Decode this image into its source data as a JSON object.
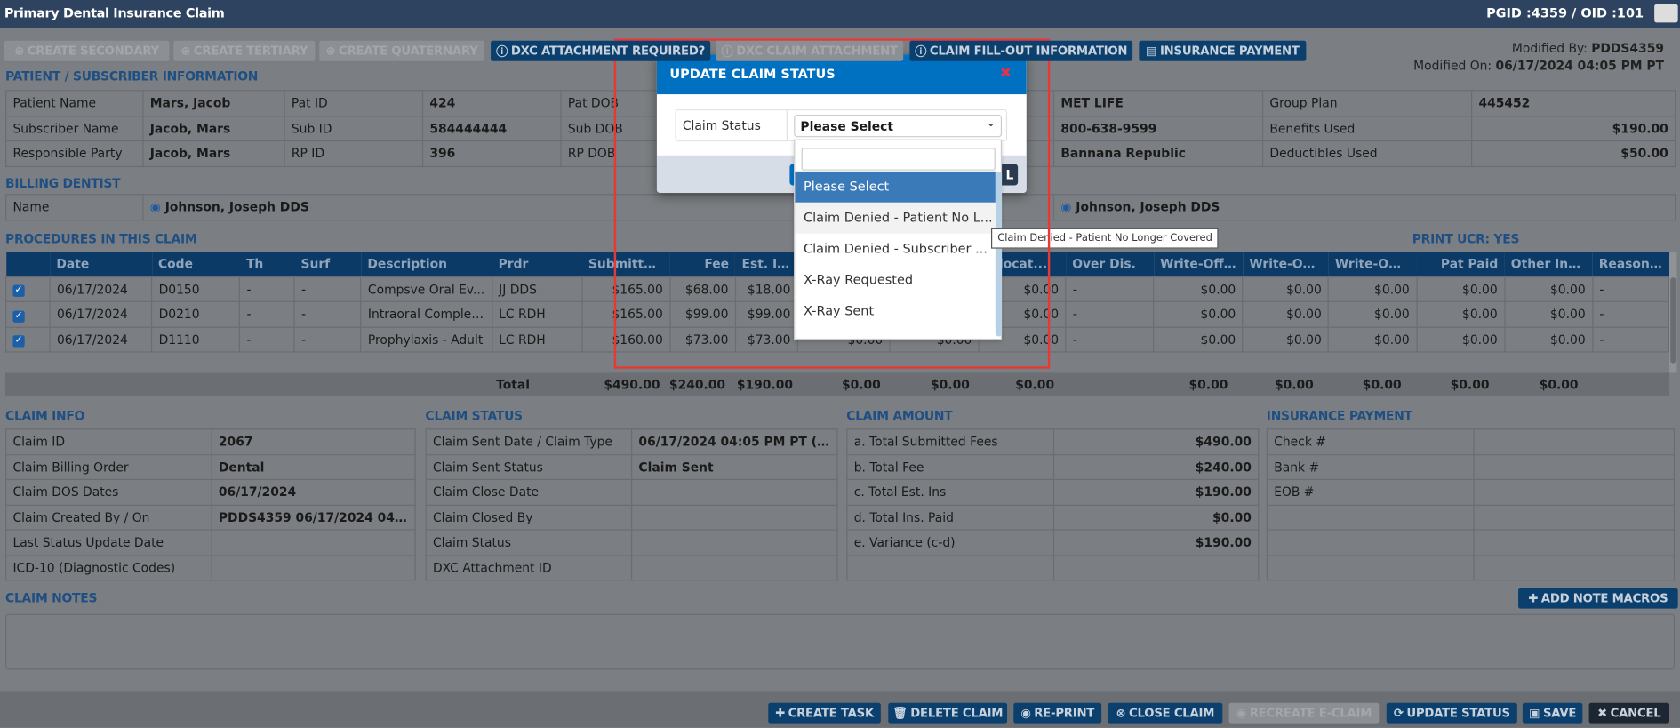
{
  "header": {
    "title": "Primary Dental Insurance Claim",
    "ids": "PGID :4359  /  OID :101"
  },
  "toolbar": [
    {
      "label": "CREATE SECONDARY",
      "icon": "plus-circle-icon",
      "disabled": true
    },
    {
      "label": "CREATE TERTIARY",
      "icon": "plus-circle-icon",
      "disabled": true
    },
    {
      "label": "CREATE QUATERNARY",
      "icon": "plus-circle-icon",
      "disabled": true
    },
    {
      "label": "DXC ATTACHMENT REQUIRED?",
      "icon": "info-icon",
      "disabled": false
    },
    {
      "label": "DXC CLAIM ATTACHMENT",
      "icon": "info-icon",
      "disabled": true
    },
    {
      "label": "CLAIM FILL-OUT INFORMATION",
      "icon": "info-icon",
      "disabled": false
    },
    {
      "label": "INSURANCE PAYMENT",
      "icon": "list-icon",
      "disabled": false
    }
  ],
  "modified": {
    "by_label": "Modified By:",
    "by": "PDDS4359",
    "on_label": "Modified On:",
    "on": "06/17/2024 04:05 PM PT"
  },
  "patient": {
    "heading": "PATIENT / SUBSCRIBER INFORMATION",
    "rows": [
      [
        "Patient Name",
        "Mars, Jacob",
        "Pat ID",
        "424",
        "Pat DOB",
        "",
        "",
        "MET LIFE",
        "Group Plan",
        "445452"
      ],
      [
        "Subscriber Name",
        "Jacob, Mars",
        "Sub ID",
        "584444444",
        "Sub DOB",
        "",
        "",
        "800-638-9599",
        "Benefits Used",
        "$190.00"
      ],
      [
        "Responsible Party",
        "Jacob, Mars",
        "RP ID",
        "396",
        "RP DOB",
        "",
        "",
        "Bannana Republic",
        "Deductibles Used",
        "$50.00"
      ]
    ]
  },
  "billing": {
    "heading": "BILLING DENTIST",
    "label": "Name",
    "dentist": "Johnson, Joseph DDS",
    "dentist2": "Johnson, Joseph DDS"
  },
  "procedures": {
    "heading": "PROCEDURES IN THIS CLAIM",
    "print_ucr": "PRINT UCR: YES",
    "columns": [
      "",
      "Date",
      "Code",
      "Th",
      "Surf",
      "Description",
      "Prdr",
      "Submitte...",
      "Fee",
      "Est. Ins",
      "",
      "",
      "Allocat...",
      "Over Dis.",
      "Write-Off ...",
      "Write-Off ...",
      "Write-Off ...",
      "Pat Paid",
      "Other Ins ...",
      "Reason Co..."
    ],
    "rows": [
      [
        "06/17/2024",
        "D0150",
        "-",
        "-",
        "Compsve Oral Ev...",
        "JJ DDS",
        "$165.00",
        "$68.00",
        "$18.00",
        "$0.00",
        "$0.00",
        "$0.00",
        "-",
        "$0.00",
        "$0.00",
        "$0.00",
        "$0.00",
        "$0.00",
        "-"
      ],
      [
        "06/17/2024",
        "D0210",
        "-",
        "-",
        "Intraoral Complet...",
        "LC RDH",
        "$165.00",
        "$99.00",
        "$99.00",
        "$0.00",
        "$0.00",
        "$0.00",
        "-",
        "$0.00",
        "$0.00",
        "$0.00",
        "$0.00",
        "$0.00",
        "-"
      ],
      [
        "06/17/2024",
        "D1110",
        "-",
        "-",
        "Prophylaxis - Adult",
        "LC RDH",
        "$160.00",
        "$73.00",
        "$73.00",
        "$0.00",
        "$0.00",
        "$0.00",
        "-",
        "$0.00",
        "$0.00",
        "$0.00",
        "$0.00",
        "$0.00",
        "-"
      ]
    ],
    "total_label": "Total",
    "totals": [
      "$490.00",
      "$240.00",
      "$190.00",
      "$0.00",
      "$0.00",
      "$0.00",
      "$0.00",
      "$0.00",
      "$0.00",
      "$0.00",
      "$0.00"
    ]
  },
  "claim_info": {
    "heading": "CLAIM INFO",
    "rows": [
      [
        "Claim ID",
        "2067"
      ],
      [
        "Claim Billing Order",
        "Dental"
      ],
      [
        "Claim DOS Dates",
        "06/17/2024"
      ],
      [
        "Claim Created By / On",
        "PDDS4359 06/17/2024 04:05 ..."
      ],
      [
        "Last Status Update Date",
        ""
      ],
      [
        "ICD-10 (Diagnostic Codes)",
        ""
      ]
    ]
  },
  "claim_status": {
    "heading": "CLAIM STATUS",
    "rows": [
      [
        "Claim Sent Date / Claim Type",
        "06/17/2024 04:05 PM PT (Pap..."
      ],
      [
        "Claim Sent Status",
        "Claim Sent"
      ],
      [
        "Claim Close Date",
        ""
      ],
      [
        "Claim Closed By",
        ""
      ],
      [
        "Claim Status",
        ""
      ],
      [
        "DXC Attachment ID",
        ""
      ]
    ]
  },
  "claim_amount": {
    "heading": "CLAIM AMOUNT",
    "rows": [
      [
        "a. Total Submitted Fees",
        "$490.00"
      ],
      [
        "b. Total Fee",
        "$240.00"
      ],
      [
        "c. Total Est. Ins",
        "$190.00"
      ],
      [
        "d. Total Ins. Paid",
        "$0.00"
      ],
      [
        "e. Variance (c-d)",
        "$190.00"
      ],
      [
        "",
        ""
      ]
    ]
  },
  "insurance_payment": {
    "heading": "INSURANCE PAYMENT",
    "rows": [
      [
        "Check #",
        ""
      ],
      [
        "Bank #",
        ""
      ],
      [
        "EOB #",
        ""
      ],
      [
        "",
        ""
      ],
      [
        "",
        ""
      ],
      [
        "",
        ""
      ]
    ]
  },
  "notes": {
    "heading": "CLAIM NOTES",
    "add_macros": "ADD NOTE MACROS",
    "value": ""
  },
  "footer": [
    {
      "label": "CREATE TASK",
      "icon": "plus-icon",
      "disabled": false
    },
    {
      "label": "DELETE CLAIM",
      "icon": "trash-icon",
      "disabled": false
    },
    {
      "label": "RE-PRINT",
      "icon": "print-icon",
      "disabled": false
    },
    {
      "label": "CLOSE CLAIM",
      "icon": "close-circle-icon",
      "disabled": false
    },
    {
      "label": "RECREATE E-CLAIM",
      "icon": "refresh-icon",
      "disabled": true
    },
    {
      "label": "UPDATE STATUS",
      "icon": "sync-icon",
      "disabled": false
    },
    {
      "label": "SAVE",
      "icon": "save-icon",
      "disabled": false
    },
    {
      "label": "CANCEL",
      "icon": "x-icon",
      "disabled": false
    }
  ],
  "modal": {
    "title": "UPDATE CLAIM STATUS",
    "field_label": "Claim Status",
    "selected": "Please Select",
    "footer_visible_label": "L",
    "search_value": "",
    "options": [
      "Please Select",
      "Claim Denied - Patient No L...",
      "Claim Denied - Subscriber ...",
      "X-Ray Requested",
      "X-Ray Sent"
    ],
    "tooltip": "Claim Denied - Patient No Longer Covered"
  },
  "colors": {
    "header": "#2e4360",
    "modal_header": "#0070c0",
    "table_header": "#0b3a66",
    "button": "#0b3f6e",
    "highlight": "#3a7ab8",
    "annotation": "#e53935"
  }
}
